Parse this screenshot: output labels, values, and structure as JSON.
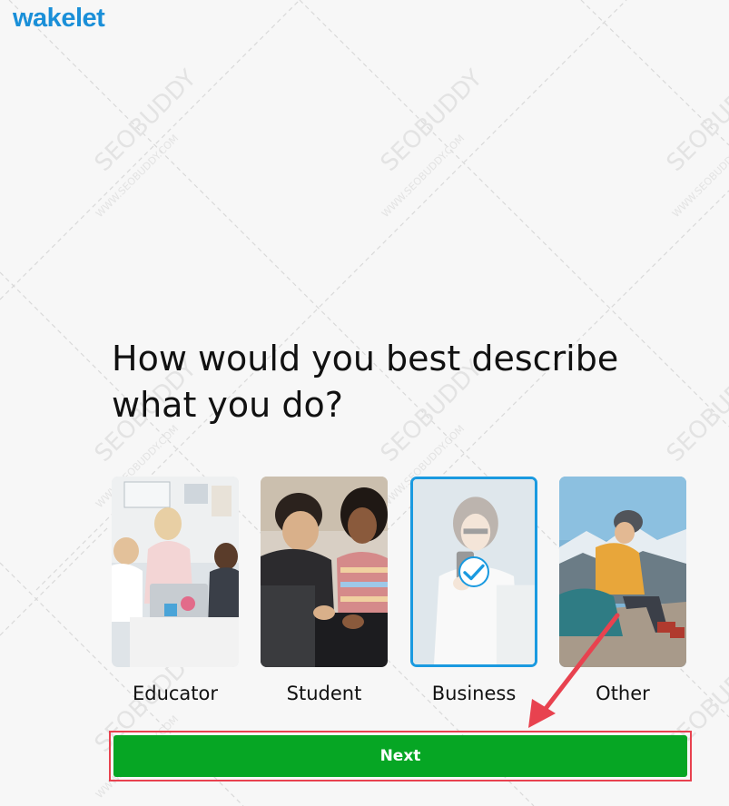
{
  "app": {
    "logo_text": "wakelet"
  },
  "question": {
    "line1": "How would you best describe",
    "line2": "what you do?"
  },
  "options": [
    {
      "label": "Educator",
      "selected": false
    },
    {
      "label": "Student",
      "selected": false
    },
    {
      "label": "Business",
      "selected": true
    },
    {
      "label": "Other",
      "selected": false
    }
  ],
  "next_button": {
    "label": "Next"
  },
  "watermark": {
    "main": "SEOBUDDY",
    "url": "WWW.SEOBUDDY.COM"
  },
  "colors": {
    "brand_blue": "#1a8fd8",
    "selected_border": "#1a9ae0",
    "next_green": "#06a624",
    "annotation_red": "#e8424f"
  }
}
